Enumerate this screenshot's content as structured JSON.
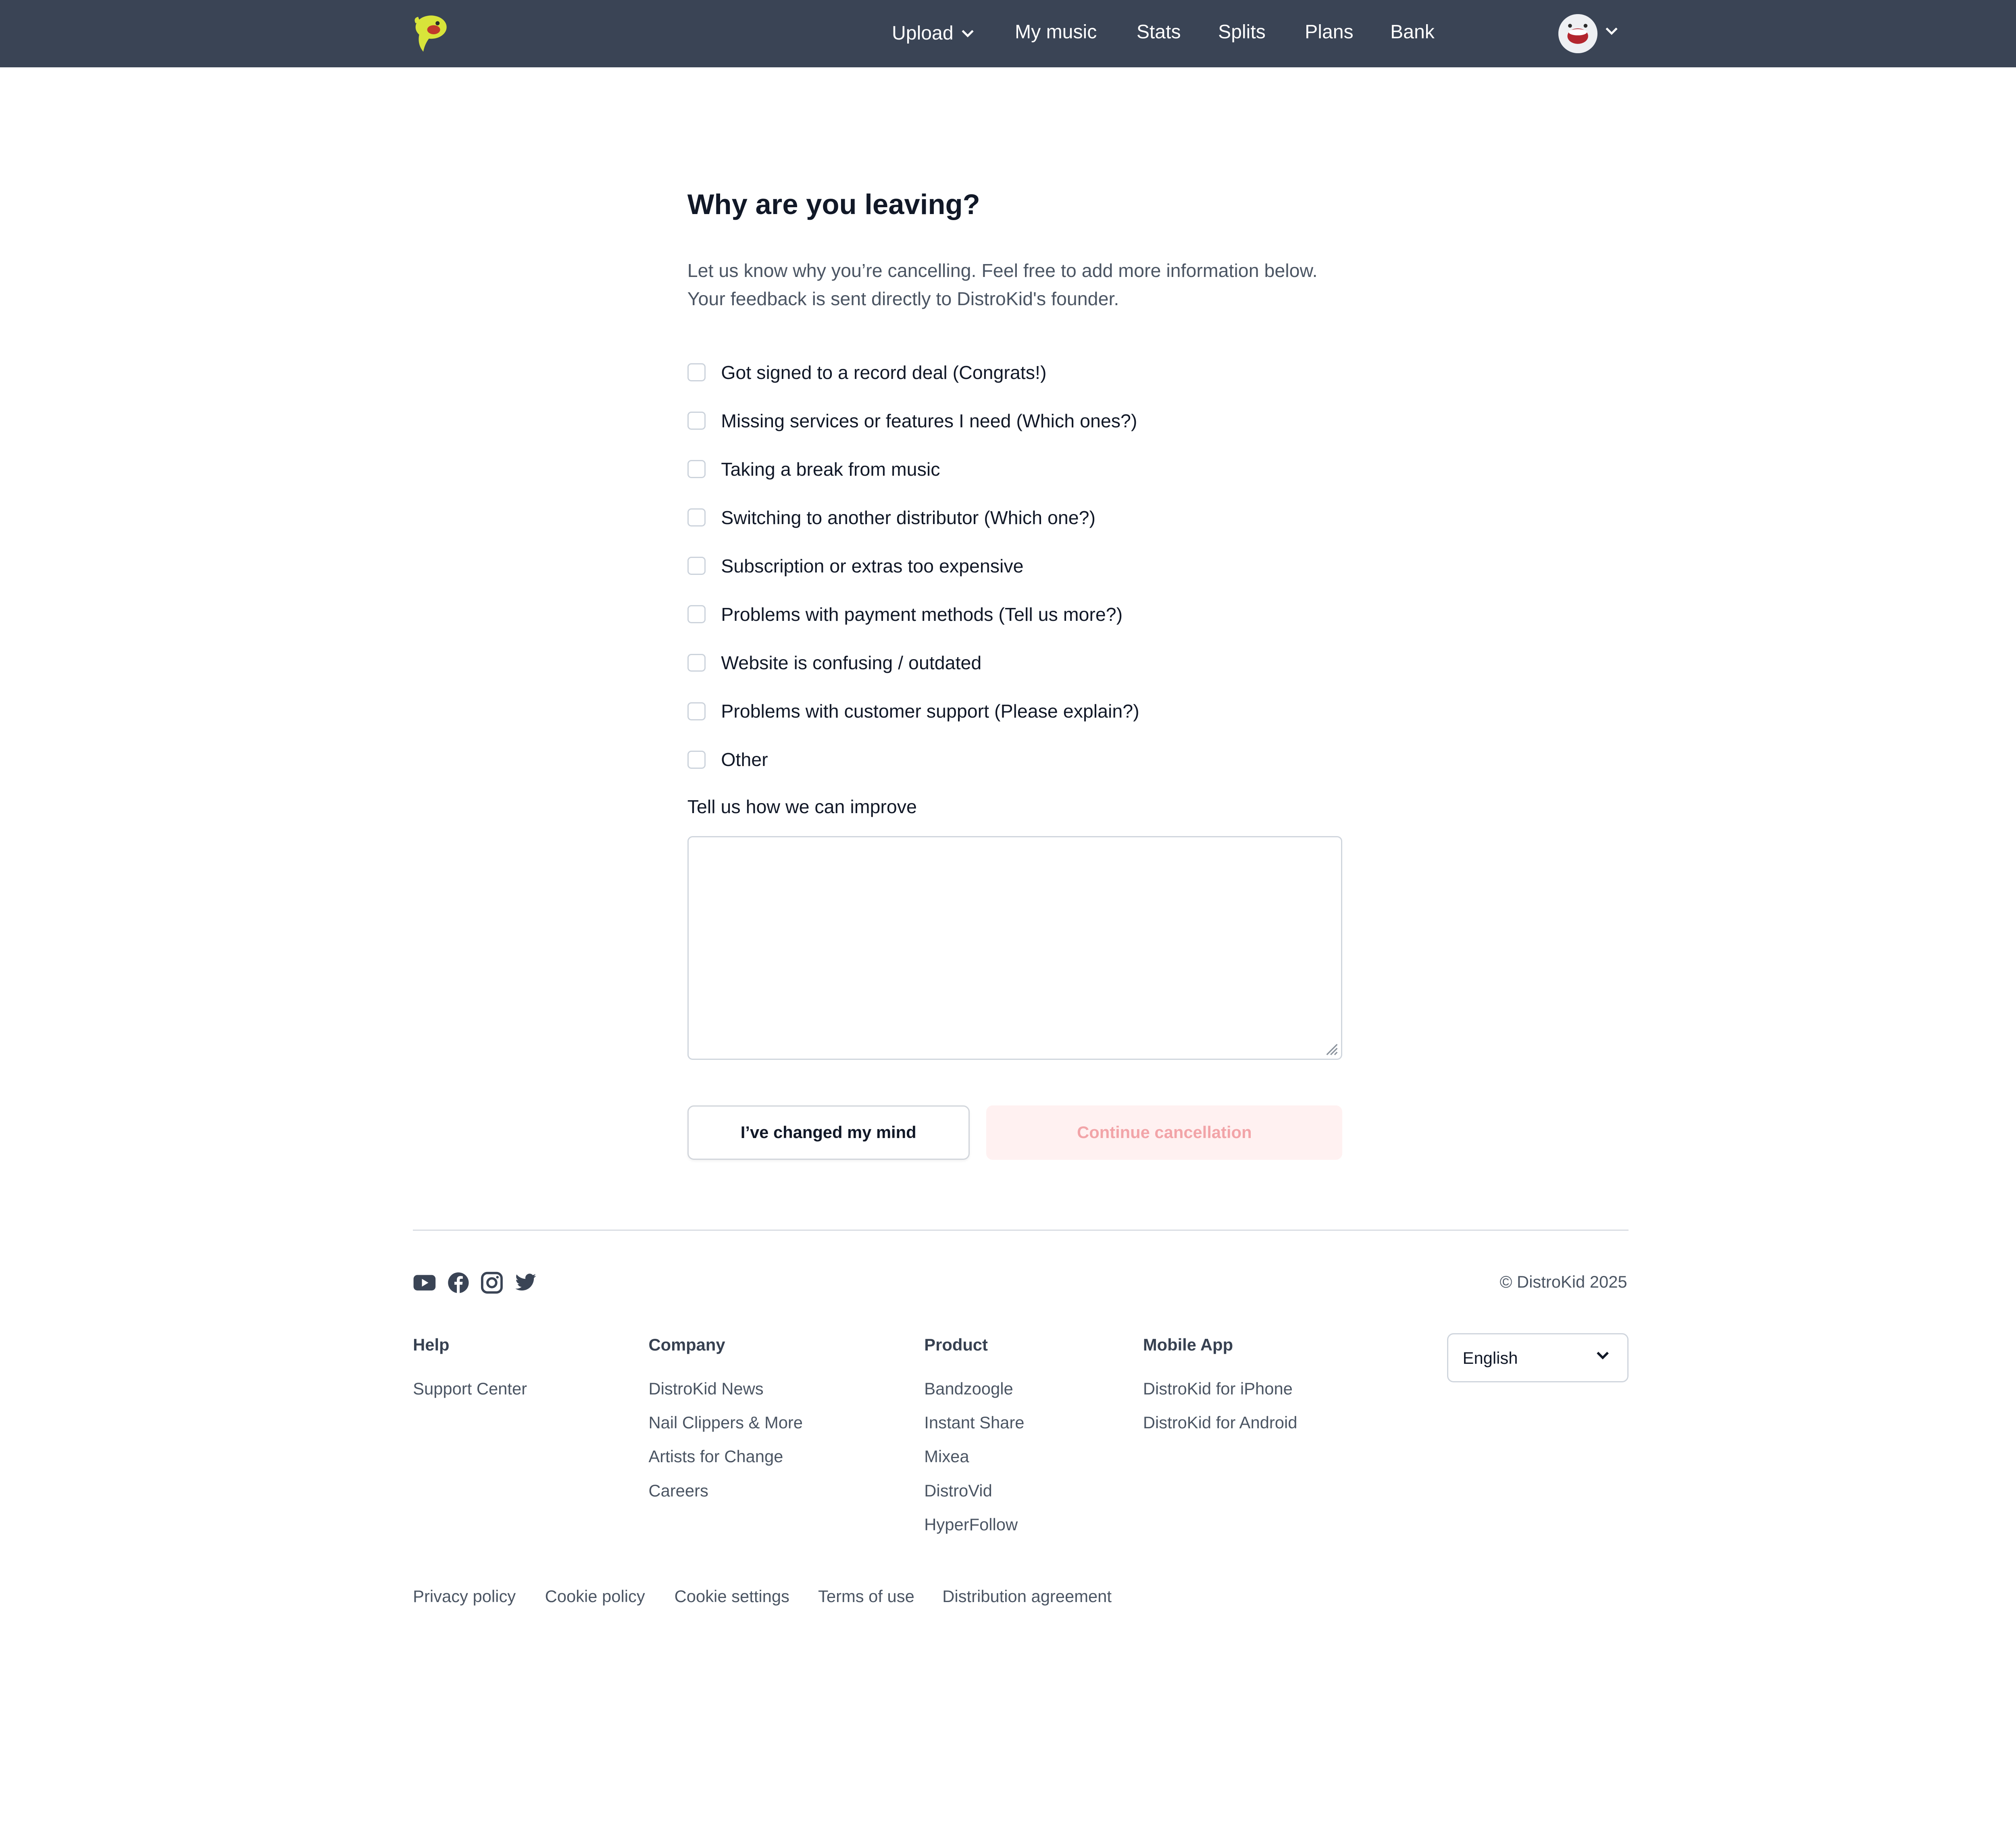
{
  "header": {
    "nav": [
      {
        "label": "Upload",
        "has_dropdown": true
      },
      {
        "label": "My music"
      },
      {
        "label": "Stats"
      },
      {
        "label": "Splits"
      },
      {
        "label": "Plans"
      },
      {
        "label": "Bank"
      }
    ],
    "logo_icon": "distrokid-mascot-logo",
    "avatar_icon": "user-avatar-mascot",
    "colors": {
      "bar": "#3a4455",
      "logo": "#d8e43a"
    }
  },
  "form": {
    "title": "Why are you leaving?",
    "intro_lines": [
      "Let us know why you’re cancelling. Feel free to add more information below.",
      "Your feedback is sent directly to DistroKid's founder."
    ],
    "reasons": [
      {
        "label": "Got signed to a record deal (Congrats!)",
        "checked": false
      },
      {
        "label": "Missing services or features I need (Which ones?)",
        "checked": false
      },
      {
        "label": "Taking a break from music",
        "checked": false
      },
      {
        "label": "Switching to another distributor (Which one?)",
        "checked": false
      },
      {
        "label": "Subscription or extras too expensive",
        "checked": false
      },
      {
        "label": "Problems with payment methods (Tell us more?)",
        "checked": false
      },
      {
        "label": "Website is confusing / outdated",
        "checked": false
      },
      {
        "label": "Problems with customer support (Please explain?)",
        "checked": false
      },
      {
        "label": "Other",
        "checked": false
      }
    ],
    "improve_label": "Tell us how we can improve",
    "feedback_value": "",
    "stay_button": "I’ve changed my mind",
    "continue_button": "Continue cancellation",
    "continue_disabled": true,
    "colors": {
      "continue_bg": "#fff1f1",
      "continue_text": "#f2a4a8"
    }
  },
  "footer": {
    "social": [
      "youtube-icon",
      "facebook-icon",
      "instagram-icon",
      "twitter-icon"
    ],
    "copyright": "© DistroKid 2025",
    "columns": [
      {
        "title": "Help",
        "links": [
          "Support Center"
        ]
      },
      {
        "title": "Company",
        "links": [
          "DistroKid News",
          "Nail Clippers & More",
          "Artists for Change",
          "Careers"
        ]
      },
      {
        "title": "Product",
        "links": [
          "Bandzoogle",
          "Instant Share",
          "Mixea",
          "DistroVid",
          "HyperFollow"
        ]
      },
      {
        "title": "Mobile App",
        "links": [
          "DistroKid for iPhone",
          "DistroKid for Android"
        ]
      }
    ],
    "language": {
      "selected": "English"
    },
    "legal": [
      "Privacy policy",
      "Cookie policy",
      "Cookie settings",
      "Terms of use",
      "Distribution agreement"
    ]
  }
}
